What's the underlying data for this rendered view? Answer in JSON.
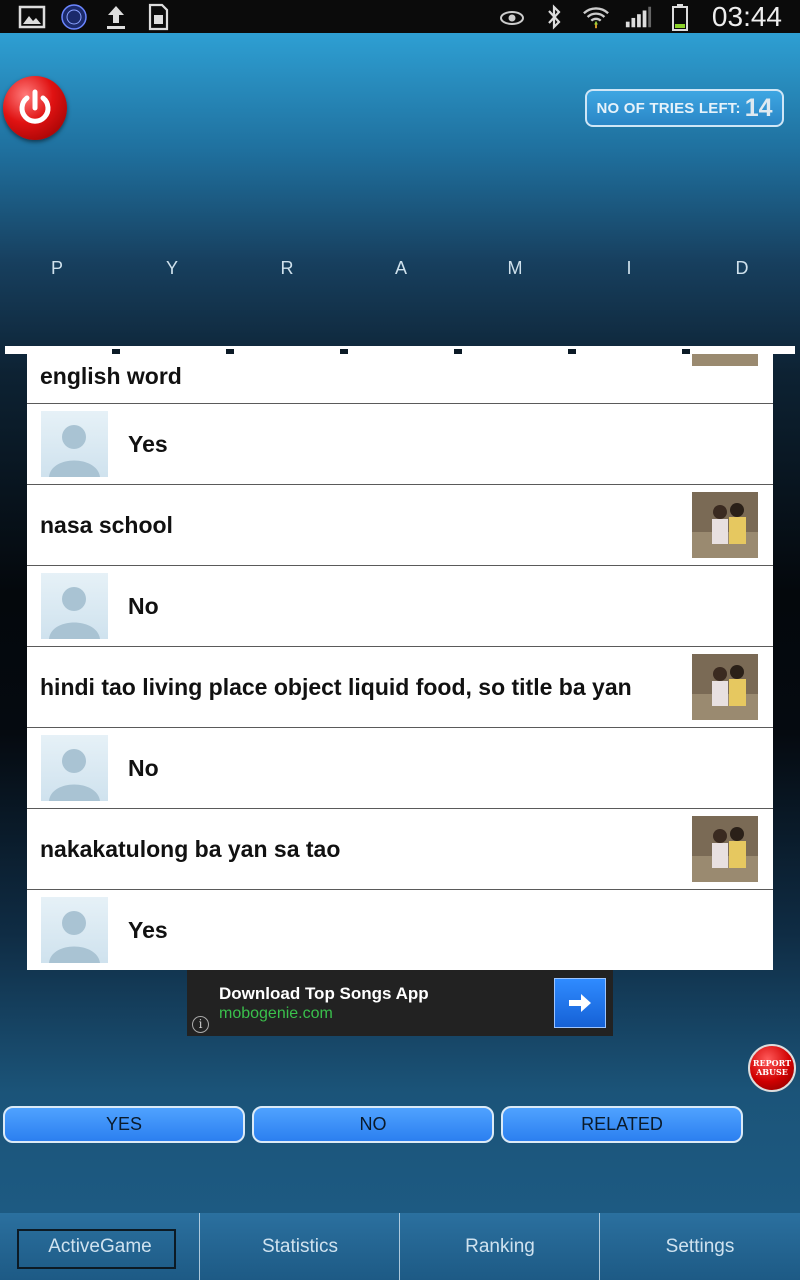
{
  "status_bar": {
    "time": "03:44",
    "left_icons": [
      "gallery-icon",
      "secret-word-app-icon",
      "upload-icon",
      "sd-card-icon"
    ],
    "right_icons": [
      "eye-icon",
      "bluetooth-icon",
      "wifi-icon",
      "signal-icon",
      "battery-icon"
    ]
  },
  "header": {
    "tries_label": "NO OF TRIES LEFT:",
    "tries_value": "14",
    "word_letters": [
      "P",
      "Y",
      "R",
      "A",
      "M",
      "I",
      "D"
    ]
  },
  "messages": [
    {
      "type": "question",
      "text": "english word"
    },
    {
      "type": "answer",
      "text": "Yes"
    },
    {
      "type": "question",
      "text": "nasa school"
    },
    {
      "type": "answer",
      "text": "No"
    },
    {
      "type": "question",
      "text": "hindi tao living place object liquid food,  so title ba yan"
    },
    {
      "type": "answer",
      "text": "No"
    },
    {
      "type": "question",
      "text": "nakakatulong  ba yan sa tao"
    },
    {
      "type": "answer",
      "text": "Yes"
    }
  ],
  "ad": {
    "title": "Download Top Songs App",
    "url": "mobogenie.com",
    "info_glyph": "i"
  },
  "report": {
    "line1": "REPORT",
    "line2": "ABUSE"
  },
  "answer_buttons": {
    "yes": "YES",
    "no": "NO",
    "related": "RELATED"
  },
  "tabs": [
    "ActiveGame",
    "Statistics",
    "Ranking",
    "Settings"
  ],
  "colors": {
    "accent": "#3a8df6",
    "header_blue": "#2e9fd3",
    "tab_bg": "#2b709f"
  }
}
